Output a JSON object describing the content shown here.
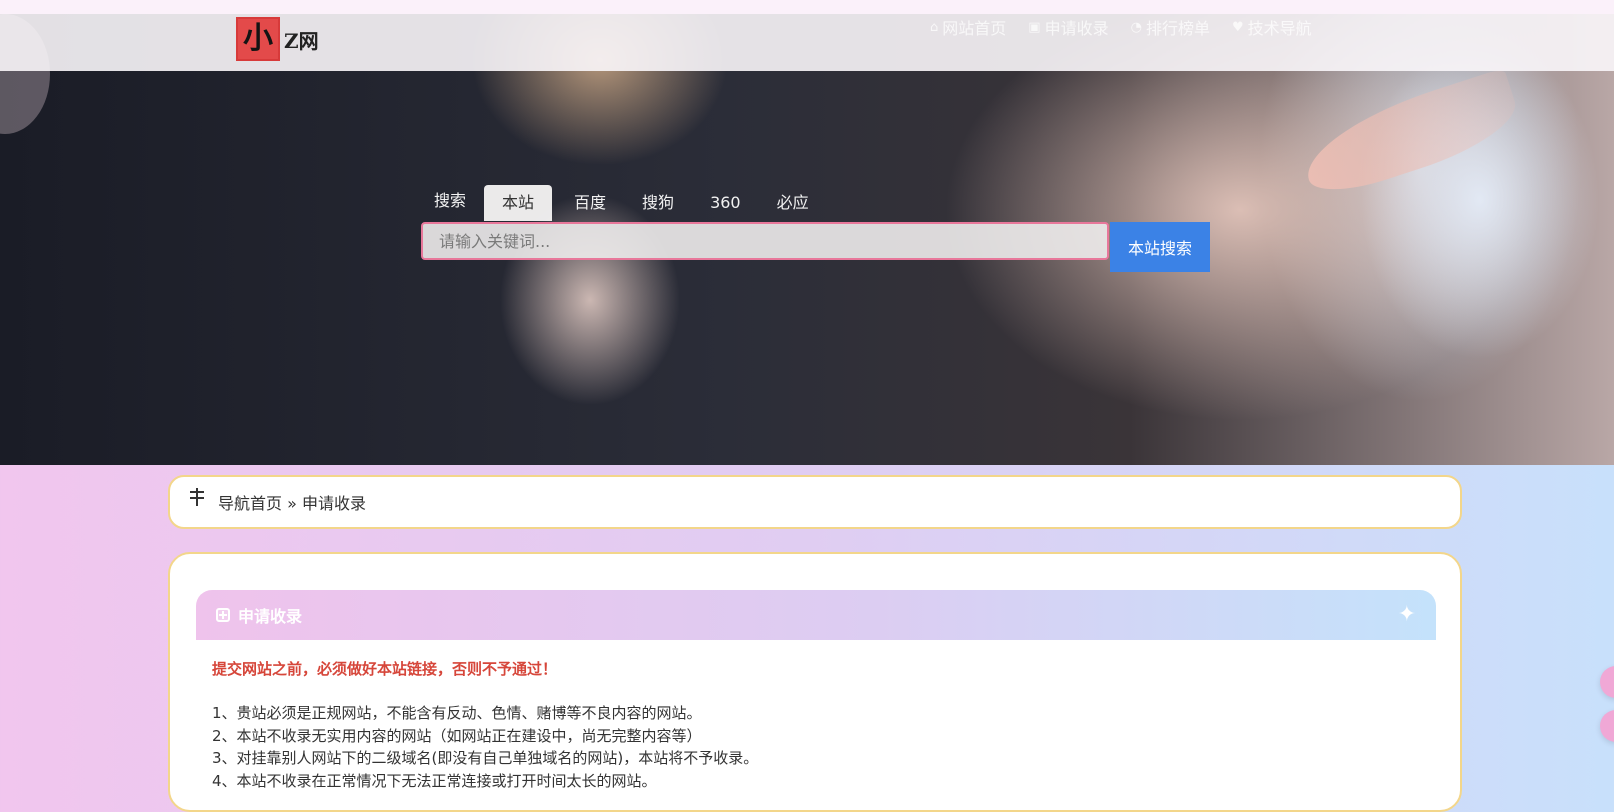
{
  "logo": {
    "mark": "小",
    "text": "Z网"
  },
  "nav": {
    "items": [
      {
        "icon": "home-icon",
        "glyph": "⌂",
        "label": "网站首页"
      },
      {
        "icon": "calendar-icon",
        "glyph": "▣",
        "label": "申请收录"
      },
      {
        "icon": "chart-icon",
        "glyph": "◔",
        "label": "排行榜单"
      },
      {
        "icon": "heart-icon",
        "glyph": "♥",
        "label": "技术导航"
      }
    ]
  },
  "search": {
    "label": "搜索",
    "tabs": [
      "本站",
      "百度",
      "搜狗",
      "360",
      "必应"
    ],
    "active_tab": "本站",
    "placeholder": "请输入关键词...",
    "button": "本站搜索"
  },
  "breadcrumb": {
    "home": "导航首页",
    "separator": "»",
    "current": "申请收录"
  },
  "section": {
    "title": "申请收录",
    "warning": "提交网站之前，必须做好本站链接，否则不予通过！",
    "rules": [
      "1、贵站必须是正规网站，不能含有反动、色情、赌博等不良内容的网站。",
      "2、本站不收录无实用内容的网站（如网站正在建设中，尚无完整内容等）",
      "3、对挂靠别人网站下的二级域名(即没有自己单独域名的网站)，本站将不予收录。",
      "4、本站不收录在正常情况下无法正常连接或打开时间太长的网站。"
    ]
  },
  "colors": {
    "accent": "#3b82e6",
    "warning": "#d6463a",
    "card_border": "#f3d68a",
    "search_border": "#e8779a"
  }
}
